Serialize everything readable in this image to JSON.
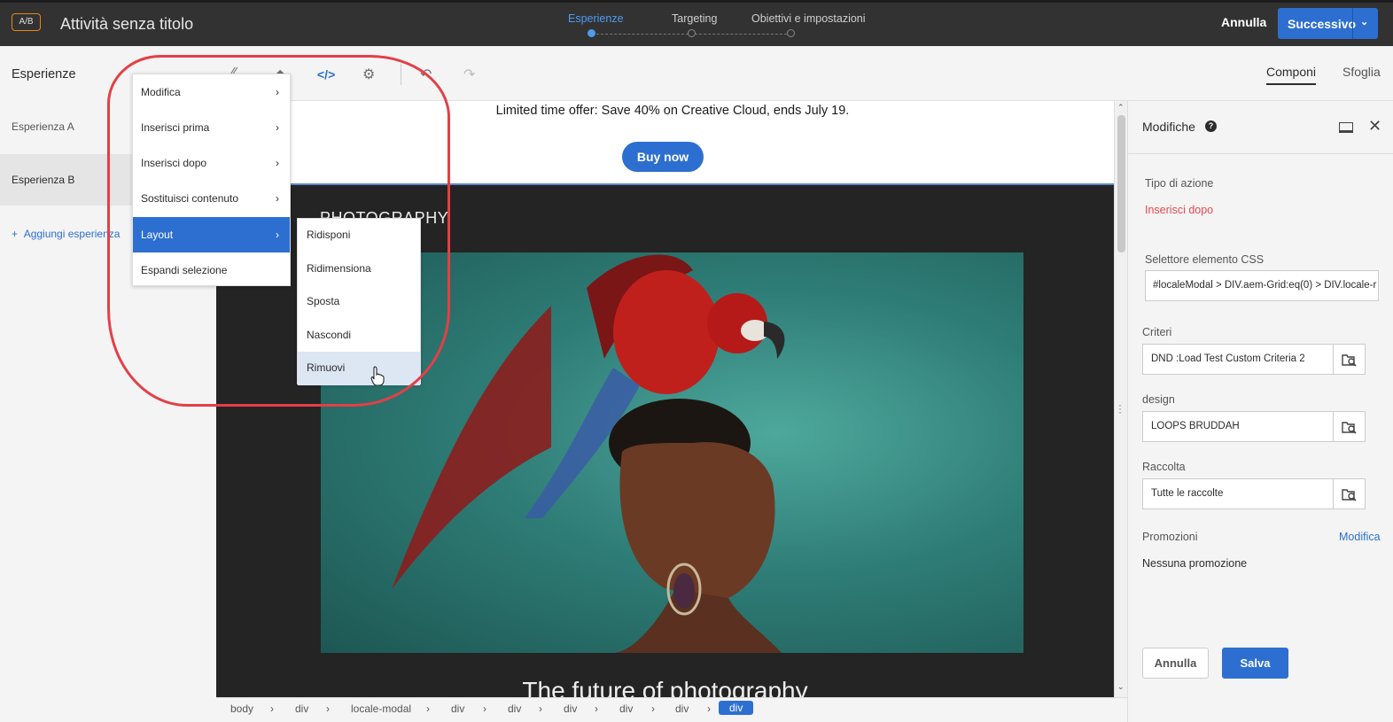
{
  "header": {
    "badge": "A/B",
    "title": "Attività senza titolo",
    "steps": [
      "Esperienze",
      "Targeting",
      "Obiettivi e impostazioni"
    ],
    "cancel": "Annulla",
    "next": "Successivo"
  },
  "left_panel": {
    "title": "Esperienze",
    "experiences": [
      "Esperienza A",
      "Esperienza B"
    ],
    "add": "Aggiungi esperienza"
  },
  "toolbar": {
    "tabs": [
      "Componi",
      "Sfoglia"
    ]
  },
  "canvas": {
    "promo_text": "Limited time offer: Save 40% on Creative Cloud, ends July 19.",
    "buy_button": "Buy now",
    "section_label": "PHOTOGRAPHY",
    "headline": "The future of photography"
  },
  "context_menu": {
    "items": [
      "Modifica",
      "Inserisci prima",
      "Inserisci dopo",
      "Sostituisci contenuto",
      "Layout",
      "Espandi selezione"
    ],
    "active": "Layout",
    "submenu": [
      "Ridisponi",
      "Ridimensiona",
      "Sposta",
      "Nascondi",
      "Rimuovi"
    ],
    "hovered": "Rimuovi"
  },
  "breadcrumb": [
    "body",
    "div",
    "locale-modal",
    "div",
    "div",
    "div",
    "div",
    "div",
    "div"
  ],
  "right_panel": {
    "title": "Modifiche",
    "action_type_label": "Tipo di azione",
    "action_type_value": "Inserisci dopo",
    "selector_label": "Selettore elemento CSS",
    "selector_value": "#localeModal > DIV.aem-Grid:eq(0) > DIV.locale-r",
    "criteria_label": "Criteri",
    "criteria_value": "DND :Load Test Custom Criteria 2",
    "design_label": "design",
    "design_value": "LOOPS BRUDDAH",
    "collection_label": "Raccolta",
    "collection_value": "Tutte le raccolte",
    "promotions_label": "Promozioni",
    "promotions_link": "Modifica",
    "promotions_value": "Nessuna promozione",
    "cancel": "Annulla",
    "save": "Salva"
  },
  "colors": {
    "accent": "#2d6fd0",
    "topbar": "#323232",
    "highlight": "#e43f47",
    "warning": "#e34850"
  }
}
